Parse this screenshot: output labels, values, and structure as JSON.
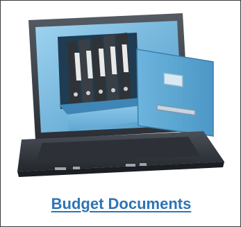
{
  "card": {
    "link_label": "Budget Documents",
    "image": {
      "icon": "laptop-file-cabinet-drawer-icon",
      "description_colors": {
        "drawer": "#5aa9d6",
        "laptop_body": "#3a3f46",
        "binders": "#2f3338"
      }
    },
    "colors": {
      "link": "#2e74b5",
      "border": "#3a3a3a"
    }
  }
}
